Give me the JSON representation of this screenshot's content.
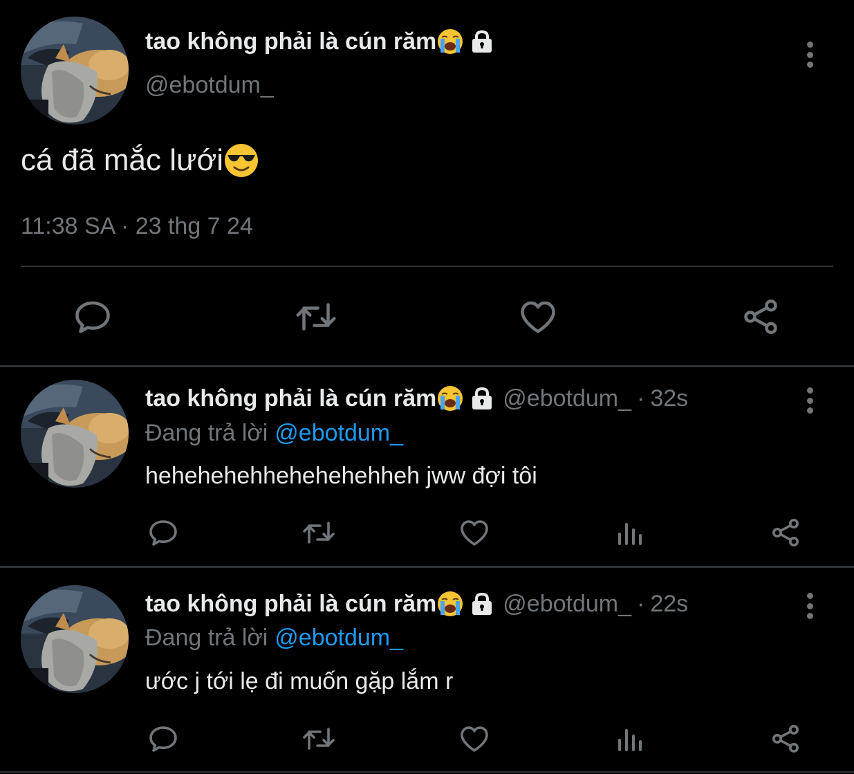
{
  "main_tweet": {
    "display_name": "tao không phải là cún răm",
    "name_emoji": "loudly-crying-face-emoji",
    "protected_icon": "lock-icon",
    "handle": "@ebotdum_",
    "text": "cá đã mắc lưới",
    "text_emoji": "smiling-face-with-sunglasses-emoji",
    "timestamp": "11:38 SA · 23 thg 7 24",
    "actions": [
      "reply-icon",
      "retweet-icon",
      "like-icon",
      "share-icon"
    ]
  },
  "replies": [
    {
      "display_name": "tao không phải là cún răm",
      "handle": "@ebotdum_",
      "separator": "·",
      "time": "32s",
      "replying_label": "Đang trả lời",
      "replying_to": "@ebotdum_",
      "text": "hehehehehhehehehehheh jww đợi tôi",
      "actions": [
        "reply-icon",
        "retweet-icon",
        "like-icon",
        "views-icon",
        "share-icon"
      ]
    },
    {
      "display_name": "tao không phải là cún răm",
      "handle": "@ebotdum_",
      "separator": "·",
      "time": "22s",
      "replying_label": "Đang trả lời",
      "replying_to": "@ebotdum_",
      "text": "ước j tới lẹ đi muốn gặp lắm r",
      "actions": [
        "reply-icon",
        "retweet-icon",
        "like-icon",
        "views-icon",
        "share-icon"
      ]
    }
  ],
  "colors": {
    "background": "#000000",
    "text": "#e7e9ea",
    "secondary": "#71767b",
    "link": "#1d9bf0",
    "divider": "#2f3336"
  }
}
